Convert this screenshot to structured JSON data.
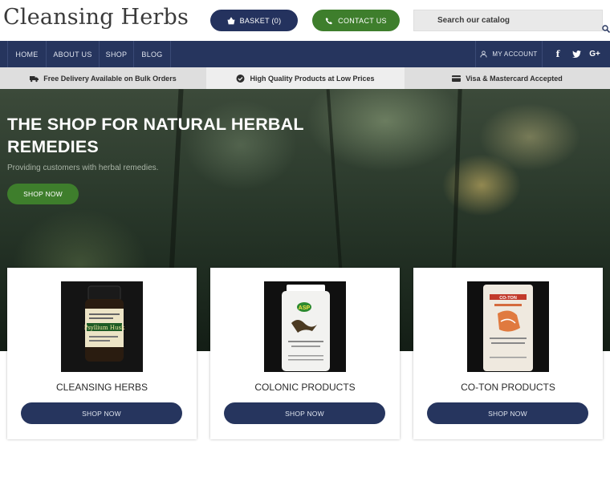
{
  "header": {
    "logo": "Cleansing Herbs",
    "basket_label": "BASKET (0)",
    "contact_label": "CONTACT US",
    "search_placeholder": "Search our catalog"
  },
  "nav": {
    "items": [
      {
        "label": "HOME"
      },
      {
        "label": "ABOUT US"
      },
      {
        "label": "SHOP"
      },
      {
        "label": "BLOG"
      }
    ],
    "account_label": "MY ACCOUNT",
    "social": [
      {
        "icon": "facebook-icon",
        "glyph": "f"
      },
      {
        "icon": "twitter-icon",
        "glyph": "t"
      },
      {
        "icon": "google-plus-icon",
        "glyph": "G+"
      }
    ]
  },
  "infobar": {
    "items": [
      {
        "icon": "truck-icon",
        "label": "Free Delivery Available on Bulk Orders"
      },
      {
        "icon": "thumbs-up-icon",
        "label": "High Quality Products at Low Prices"
      },
      {
        "icon": "credit-card-icon",
        "label": "Visa & Mastercard Accepted"
      }
    ]
  },
  "hero": {
    "title": "THE SHOP FOR NATURAL HERBAL REMEDIES",
    "subtitle": "Providing customers with herbal remedies.",
    "button_label": "SHOP NOW"
  },
  "products": [
    {
      "title": "CLEANSING HERBS",
      "button_label": "SHOP NOW",
      "image_label": "Psyllium Husk"
    },
    {
      "title": "COLONIC PRODUCTS",
      "button_label": "SHOP NOW",
      "image_label": "ASP"
    },
    {
      "title": "CO-TON PRODUCTS",
      "button_label": "SHOP NOW",
      "image_label": "CO-TON"
    }
  ],
  "colors": {
    "navy": "#26355e",
    "green": "#3e7e2c",
    "infobar": "#dedede"
  }
}
